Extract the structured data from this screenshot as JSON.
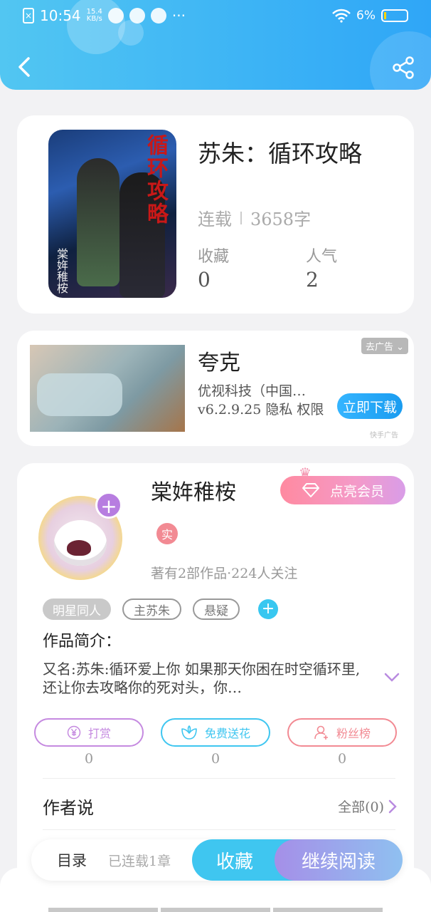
{
  "status_bar": {
    "time": "10:54",
    "speed_value": "15.4",
    "speed_unit": "KB/s",
    "more": "···",
    "battery": "6%"
  },
  "header": {
    "back_icon": "chevron-left-icon",
    "share_icon": "share-icon",
    "accent": "#3cb3f5"
  },
  "book": {
    "title": "苏朱：循环攻略",
    "status": "连载",
    "word_count": "3658字",
    "collect_label": "收藏",
    "collect_value": "0",
    "popularity_label": "人气",
    "popularity_value": "2",
    "cover_title": "循环攻略",
    "cover_author": "棠姩稚桉"
  },
  "ad": {
    "title": "夸克",
    "line1": "优视科技（中国…",
    "line2": "v6.2.9.25 隐私 权限",
    "tag": "去广告",
    "download": "立即下载",
    "source": "快手广告"
  },
  "author": {
    "name": "棠姩稚桉",
    "vip_button": "点亮会员",
    "real_badge": "实",
    "stats": "著有2部作品·224人关注",
    "tags": [
      "明星同人",
      "主苏朱",
      "悬疑"
    ],
    "intro_title": "作品简介：",
    "intro_text": "又名:苏朱:循环爱上你 如果那天你困在时空循环里,还让你去攻略你的死对头，你…",
    "actions": [
      {
        "label": "打赏",
        "count": "0",
        "icon": "yen-icon",
        "color": "#c58ae0"
      },
      {
        "label": "免费送花",
        "count": "0",
        "icon": "flower-icon",
        "color": "#3fc6f0"
      },
      {
        "label": "粉丝榜",
        "count": "0",
        "icon": "user-icon",
        "color": "#f28a93"
      }
    ],
    "author_said": "作者说",
    "author_said_all": "全部(0)"
  },
  "bottom_bar": {
    "toc": "目录",
    "progress": "已连载1章",
    "collect": "收藏",
    "continue": "继续阅读"
  }
}
